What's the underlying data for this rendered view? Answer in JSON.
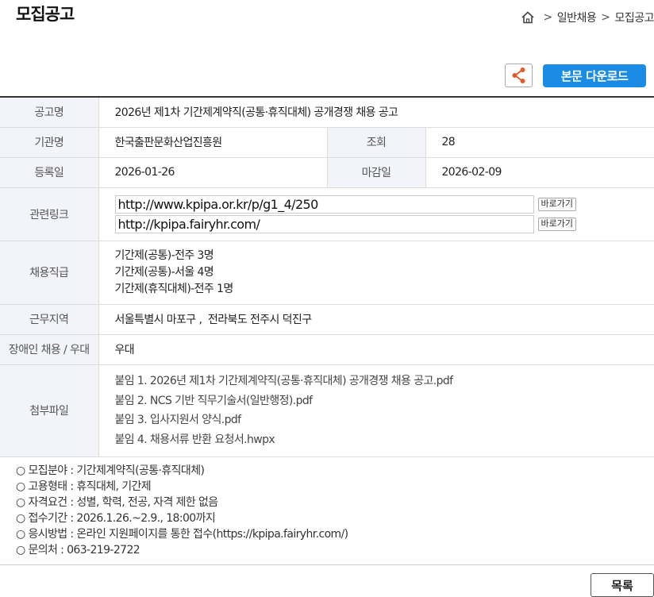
{
  "page_title": "모집공고",
  "breadcrumb": {
    "sep": ">",
    "items": [
      "일반채용",
      "모집공고"
    ]
  },
  "toolbar": {
    "download_label": "본문 다운로드"
  },
  "table": {
    "title_label": "공고명",
    "title_value": "2026년 제1차 기간제계약직(공통·휴직대체) 공개경쟁 채용 공고",
    "org_label": "기관명",
    "org_value": "한국출판문화산업진흥원",
    "views_label": "조회",
    "views_value": "28",
    "reg_label": "등록일",
    "reg_value": "2026-01-26",
    "deadline_label": "마감일",
    "deadline_value": "2026-02-09",
    "links_label": "관련링크",
    "links": [
      {
        "url": "http://www.kpipa.or.kr/p/g1_4/250",
        "go_label": "바로가기"
      },
      {
        "url": "http://kpipa.fairyhr.com/",
        "go_label": "바로가기"
      }
    ],
    "positions_label": "채용직급",
    "positions": [
      "기간제(공통)-전주 3명",
      "기간제(공통)-서울 4명",
      "기간제(휴직대체)-전주 1명"
    ],
    "region_label": "근무지역",
    "region_value": "서울특별시 마포구 ,  전라북도 전주시 덕진구",
    "disabled_label": "장애인 채용 / 우대",
    "disabled_value": "우대",
    "files_label": "첨부파일",
    "files": [
      "붙임 1. 2026년 제1차 기간제계약직(공통·휴직대체) 공개경쟁 채용 공고.pdf",
      "붙임 2. NCS 기반 직무기술서(일반행정).pdf",
      "붙임 3. 입사지원서 양식.pdf",
      "붙임 4. 채용서류 반환 요청서.hwpx"
    ]
  },
  "notes": [
    "○ 모집분야 : 기간제계약직(공통·휴직대체)",
    "○ 고용형태 : 휴직대체, 기간제",
    "○ 자격요건 : 성별, 학력, 전공, 자격 제한 없음",
    "○ 접수기간 : 2026.1.26.~2.9., 18:00까지",
    "○ 응시방법 : 온라인 지원페이지를 통한 접수(https://kpipa.fairyhr.com/)",
    "○ 문의처 : 063-219-2722"
  ],
  "footer": {
    "list_label": "목록"
  },
  "colors": {
    "accent": "#1a8ce6",
    "label_bg": "#f2f4f9",
    "share_icon": "#e05a2b"
  },
  "icons": {
    "home": "home-icon",
    "share": "share-icon"
  }
}
